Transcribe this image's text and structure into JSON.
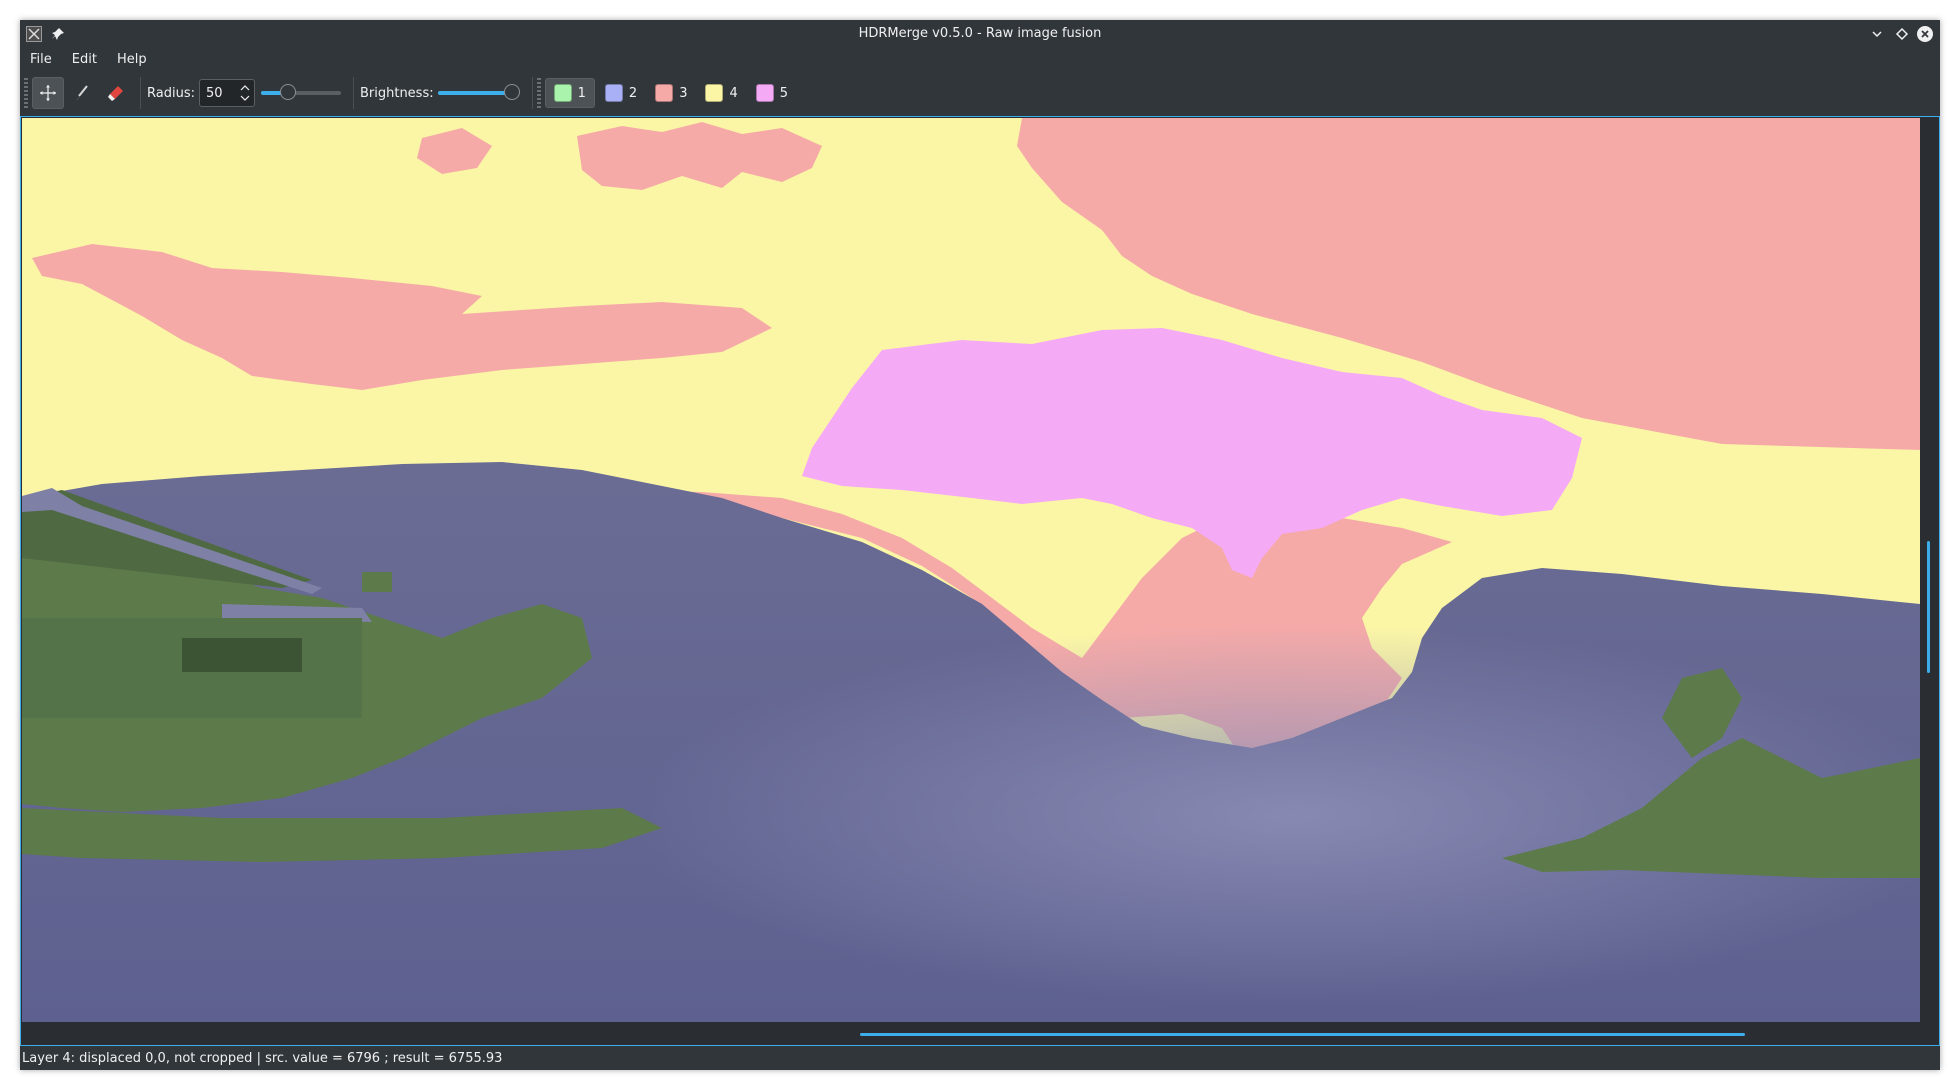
{
  "window": {
    "title": "HDRMerge v0.5.0 - Raw image fusion"
  },
  "menu": {
    "items": [
      "File",
      "Edit",
      "Help"
    ]
  },
  "toolbar": {
    "radius_label": "Radius:",
    "radius_value": "50",
    "radius_slider_fraction": 0.3,
    "brightness_label": "Brightness:",
    "brightness_slider_fraction": 1.0,
    "active_tool": "move",
    "layers": [
      {
        "label": "1",
        "color": "#a9f3ad",
        "active": true
      },
      {
        "label": "2",
        "color": "#aab0f5",
        "active": false
      },
      {
        "label": "3",
        "color": "#f5aaa8",
        "active": false
      },
      {
        "label": "4",
        "color": "#fbf6a6",
        "active": false
      },
      {
        "label": "5",
        "color": "#f5aaf6",
        "active": false
      }
    ]
  },
  "statusbar": {
    "text": "Layer 4: displaced 0,0, not cropped | src. value = 6796 ; result = 6755.93"
  },
  "colors": {
    "accent": "#3daee9",
    "window_bg": "#31363b"
  }
}
